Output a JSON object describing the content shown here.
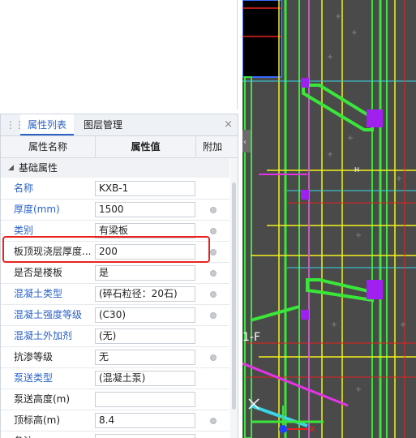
{
  "panel": {
    "tabs": [
      {
        "label": "属性列表"
      },
      {
        "label": "图层管理"
      }
    ],
    "close_label": "×",
    "headers": {
      "name": "属性名称",
      "value": "属性值",
      "extra": "附加"
    },
    "group_label": "基础属性",
    "rows": [
      {
        "name": "名称",
        "value": "KXB-1",
        "link": true,
        "dot": false
      },
      {
        "name": "厚度(mm)",
        "value": "1500",
        "link": true,
        "dot": true
      },
      {
        "name": "类别",
        "value": "有梁板",
        "link": true,
        "dot": true
      },
      {
        "name": "板顶现浇层厚度...",
        "value": "200",
        "link": false,
        "dot": true
      },
      {
        "name": "是否是楼板",
        "value": "是",
        "link": false,
        "dot": true
      },
      {
        "name": "混凝土类型",
        "value": "(碎石粒径：20石)",
        "link": true,
        "dot": true
      },
      {
        "name": "混凝土强度等级",
        "value": "(C30)",
        "link": true,
        "dot": true
      },
      {
        "name": "混凝土外加剂",
        "value": "(无)",
        "link": true,
        "dot": false
      },
      {
        "name": "抗渗等级",
        "value": "无",
        "link": false,
        "dot": true
      },
      {
        "name": "泵送类型",
        "value": "(混凝土泵)",
        "link": true,
        "dot": false
      },
      {
        "name": "泵送高度(m)",
        "value": "",
        "link": false,
        "dot": false
      },
      {
        "name": "顶标高(m)",
        "value": "8.4",
        "link": false,
        "dot": true
      },
      {
        "name": "备注",
        "value": "",
        "link": false,
        "dot": true
      }
    ]
  },
  "cad": {
    "label_f": "1-F",
    "label_h": "H",
    "axis_x": "X",
    "colors": {
      "background": "#4a4a4a",
      "green": "#39e639",
      "yellow": "#f2f21a",
      "magenta": "#e533e5",
      "cyan": "#3ad6e6",
      "red": "#e8231f",
      "purple": "#a020f0"
    }
  }
}
